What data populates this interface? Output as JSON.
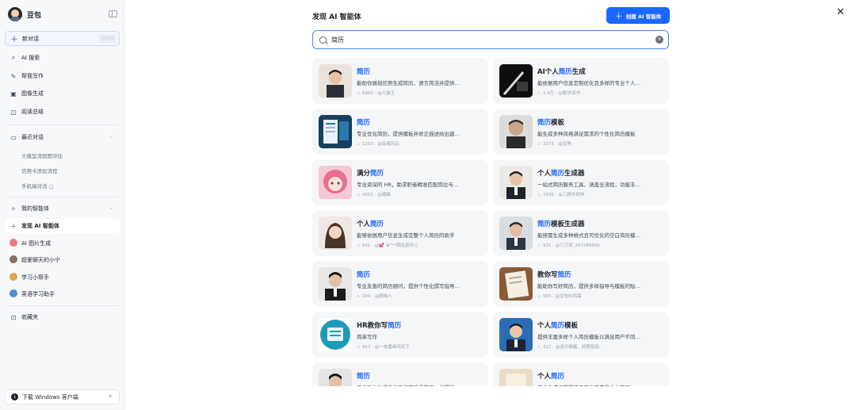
{
  "sidebar": {
    "brand": "豆包",
    "new_chat": {
      "label": "新对话",
      "shortcut": "Ctrl K"
    },
    "nav": [
      {
        "icon": "ai-search-icon",
        "label": "AI 搜索"
      },
      {
        "icon": "writing-icon",
        "label": "帮我写作"
      },
      {
        "icon": "image-icon",
        "label": "图像生成"
      },
      {
        "icon": "reading-icon",
        "label": "阅读总结"
      }
    ],
    "recent": {
      "label": "最近对话",
      "items": [
        "大模型流程图评估",
        "信用卡添加流程",
        "手机端对话 ▢"
      ]
    },
    "my_agents": {
      "label": "我的智能体",
      "discover": "发现 AI 智能体",
      "items": [
        "AI 图片生成",
        "超爱聊天的小宁",
        "学习小帮手",
        "英语学习助手"
      ]
    },
    "favorites": "收藏夹",
    "download": "下载 Windows 客户端"
  },
  "main": {
    "title": "发现 AI 智能体",
    "create_label": "创建 AI 智能体",
    "search_value": "简历",
    "cards": [
      {
        "pre": "",
        "hl": "简历",
        "post": "",
        "desc": "能助你展现优势生成简历，语言简洁并提供…",
        "count": "6983",
        "author": "@人脉王"
      },
      {
        "pre": "AI个人",
        "hl": "简历",
        "post": "生成",
        "desc": "能依据用户信息定制优化且多样的专业个人…",
        "count": "1.4万",
        "author": "@勤学读书"
      },
      {
        "pre": "",
        "hl": "简历",
        "post": "",
        "desc": "专业优化简历，提供模板并修正描述给出建…",
        "count": "1250",
        "author": "@采薇风云"
      },
      {
        "pre": "",
        "hl": "简历",
        "post": "模板",
        "desc": "能生成多种风格满足需求的个性化简历模板",
        "count": "3373",
        "author": "@豆角"
      },
      {
        "pre": "满分",
        "hl": "简历",
        "post": "",
        "desc": "专业资深的 HR，助求职者精准匹配岗位与…",
        "count": "4352",
        "author": "@橘猫"
      },
      {
        "pre": "个人",
        "hl": "简历",
        "post": "生成器",
        "desc": "一站式简历服务工具，涵盖全流程，功能丰…",
        "count": "1556",
        "author": "@三顾半妖怖"
      },
      {
        "pre": "个人",
        "hl": "简历",
        "post": "",
        "desc": "能够依据用户信息生成完整个人简历的助手",
        "count": "631",
        "author": "@💕 ♛²⁰¹⁹陌往彭吟♫"
      },
      {
        "pre": "",
        "hl": "简历",
        "post": "模板生成器",
        "desc": "能按需生成多种格式且可优化的空白简历模…",
        "count": "931",
        "author": "@三刀流_247289592"
      },
      {
        "pre": "",
        "hl": "简历",
        "post": "",
        "desc": "专业友善的简历顾问，提供个性化撰写指导…",
        "count": "204",
        "author": "@随缘人"
      },
      {
        "pre": "教你写",
        "hl": "简历",
        "post": "",
        "desc": "能助你写好简历，提供多样指导与模板的贴…",
        "count": "555",
        "author": "@豆包炒鸡蛋"
      },
      {
        "pre": "HR教你写",
        "hl": "简历",
        "post": "",
        "desc": "简单写作",
        "count": "417",
        "author": "@一本厘画闯天下"
      },
      {
        "pre": "个人",
        "hl": "简历",
        "post": "模板",
        "desc": "提供丰富多样个人简历模板以满足用户不同…",
        "count": "412",
        "author": "@龙行崛崛、前程丽丽。"
      },
      {
        "pre": "",
        "hl": "简历",
        "post": "",
        "desc": "专业助力生成多样且规范质量简历，并提供…",
        "count": "",
        "author": ""
      },
      {
        "pre": "个人",
        "hl": "简历",
        "post": "",
        "desc": "专业生成规范简洁且突出要素的个人简历",
        "count": "",
        "author": ""
      }
    ]
  },
  "colors": {
    "accent": "#1a66ff",
    "card_bg": "#f5f6f7",
    "sidebar_bg": "#f7f8fa"
  }
}
